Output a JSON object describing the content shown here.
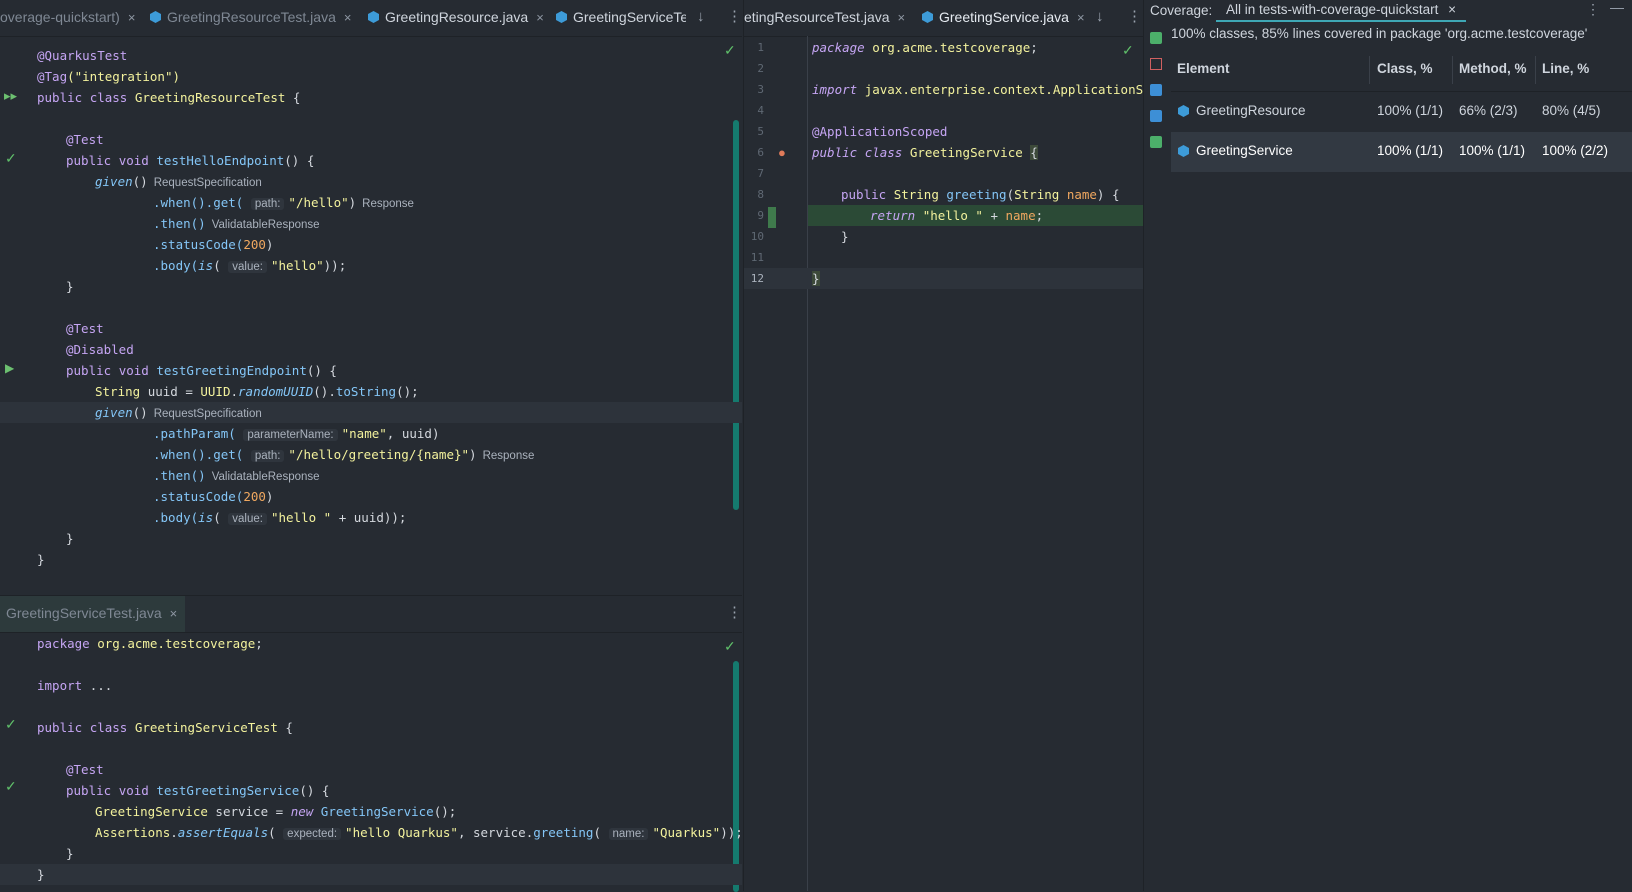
{
  "left_top": {
    "tabs": [
      {
        "label": "overage-quickstart)",
        "close": "×"
      },
      {
        "label": "GreetingResourceTest.java",
        "close": "×"
      },
      {
        "label": "GreetingResource.java",
        "close": "×"
      },
      {
        "label": "GreetingServiceTes"
      }
    ],
    "gutter_marks": {
      "run_all": "▸▸",
      "run": "▶",
      "passed": "✓"
    },
    "param_hints": {
      "path": "path:",
      "value": "value:",
      "parameterName": "parameterName:"
    },
    "type_hints": {
      "request": "RequestSpecification",
      "response": "Response",
      "validatable": "ValidatableResponse"
    },
    "code": {
      "quarkus_test": "@QuarkusTest",
      "tag": "@Tag",
      "tag_arg": "(\"integration\")",
      "public": "public",
      "class": "class",
      "void": "void",
      "class_name": "GreetingResourceTest",
      "test_ann": "@Test",
      "disabled_ann": "@Disabled",
      "method1": "testHelloEndpoint",
      "method2": "testGreetingEndpoint",
      "given": "given",
      "when_get": ".when().get(",
      "then": ".then()",
      "status_code": ".statusCode(",
      "status_value": "200",
      "body": ".body(",
      "is": "is",
      "hello_path": "\"/hello\"",
      "hello_value": "\"hello\"",
      "string_type": "String",
      "uuid_var": "uuid",
      "uuid_class": "UUID",
      "random_uuid": "randomUUID",
      "to_string": "toString",
      "path_param": ".pathParam(",
      "name_str": "\"name\"",
      "greeting_path": "\"/hello/greeting/{name}\"",
      "hello_space": "\"hello \"",
      "open_brace": "{",
      "close_brace": "}"
    }
  },
  "left_bottom": {
    "tab": {
      "label": "GreetingServiceTest.java",
      "close": "×"
    },
    "code": {
      "package_kw": "package",
      "package_name": "org.acme.testcoverage",
      "import_kw": "import",
      "import_rest": "...",
      "class_name": "GreetingServiceTest",
      "method": "testGreetingService",
      "service_type": "GreetingService",
      "service_var": "service",
      "new_kw": "new",
      "assertions": "Assertions",
      "assert_equals": "assertEquals",
      "expected_hint": "expected:",
      "expected_value": "\"hello Quarkus\"",
      "greeting_call": "greeting",
      "name_hint": "name:",
      "quarkus_str": "\"Quarkus\""
    }
  },
  "middle": {
    "tabs": [
      {
        "label": "etingResourceTest.java",
        "close": "×"
      },
      {
        "label": "GreetingService.java",
        "close": "×"
      }
    ],
    "line_numbers": [
      "1",
      "2",
      "3",
      "4",
      "5",
      "6",
      "7",
      "8",
      "9",
      "10",
      "11",
      "12"
    ],
    "code": {
      "import_path": "javax.enterprise.context.ApplicationScc",
      "app_scoped": "@ApplicationScoped",
      "class_name": "GreetingService",
      "string_type": "String",
      "greeting": "greeting",
      "param": "name",
      "return_kw": "return",
      "hello_space": "\"hello \"",
      "plus": "+"
    }
  },
  "coverage": {
    "title": "Coverage:",
    "tab": "All in tests-with-coverage-quickstart",
    "tab_close": "×",
    "summary": "100% classes, 85% lines covered in package 'org.acme.testcoverage'",
    "columns": [
      "Element",
      "Class, %",
      "Method, %",
      "Line, %"
    ],
    "rows": [
      {
        "name": "GreetingResource",
        "class": "100% (1/1)",
        "method": "66% (2/3)",
        "line": "80% (4/5)"
      },
      {
        "name": "GreetingService",
        "class": "100% (1/1)",
        "method": "100% (1/1)",
        "line": "100% (2/2)"
      }
    ]
  },
  "icons": [
    "class-icon",
    "check-icon",
    "run-icon",
    "more-icon",
    "arrow-down-icon",
    "close-icon",
    "minimize-icon"
  ],
  "colors": {
    "accent": "#3ea7b5",
    "covered_line": "#2b4a36",
    "editor_bg": "#262b32",
    "selected_row": "#2f3640"
  }
}
